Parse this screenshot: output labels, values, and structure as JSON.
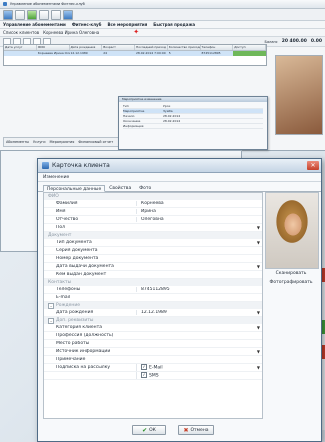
{
  "app": {
    "title": "Управление абонементами Фитнес-клуб",
    "menu": [
      "Управление абонементами",
      "Фитнес-клуб",
      "Все мероприятия",
      "Быстрая продажа"
    ],
    "subtabs": [
      "Список клиентов",
      "Корнеева Ирина Олеговна"
    ],
    "balance_label": "Баланс",
    "balance_value": "20 400.00",
    "balance_value2": "0.00",
    "grid_headers": [
      "Дата услуг",
      "ФИО",
      "Дата рождения",
      "Возраст",
      "Последний приход",
      "Количество приходов",
      "Телефон",
      "Доступ"
    ],
    "grid_row": [
      "",
      "Корнеева Ирина Олеговна",
      "12.12.1989",
      "24",
      "28.02.2014 7:00:00",
      "5",
      "8745112895",
      ""
    ],
    "lower_tabs": [
      "Абонементы",
      "Услуги",
      "Мероприятия",
      "Финансовый отчет"
    ]
  },
  "small_dialog": {
    "title": "Мероприятие изменение",
    "rows": [
      {
        "label": "Тип",
        "value": "Урок"
      },
      {
        "label": "Мероприятие",
        "value": "Зумба"
      },
      {
        "label": "Начало",
        "value": "28.02.2014"
      },
      {
        "label": "Окончание",
        "value": "28.02.2014"
      },
      {
        "label": "Информация",
        "value": ""
      }
    ]
  },
  "dialog": {
    "title": "Карточка клиента",
    "menu_label": "Изменение",
    "tabs": [
      "Персональные данные",
      "Свойства",
      "Фото"
    ],
    "categories": {
      "fio": "ФИО",
      "document": "Документ",
      "contacts": "Контакты",
      "birth": "Рождение",
      "extra": "Доп. реквизиты"
    },
    "fields": {
      "last_name": {
        "label": "Фамилия",
        "value": "Корнеева"
      },
      "first_name": {
        "label": "Имя",
        "value": "Ирина"
      },
      "patronymic": {
        "label": "Отчество",
        "value": "Олеговна"
      },
      "gender": {
        "label": "Пол",
        "value": ""
      },
      "doc_type": {
        "label": "Тип документа",
        "value": ""
      },
      "doc_series": {
        "label": "Серия документа",
        "value": ""
      },
      "doc_number": {
        "label": "Номер документа",
        "value": ""
      },
      "doc_issue_date": {
        "label": "Дата выдачи документа",
        "value": ""
      },
      "doc_issued_by": {
        "label": "Кем выдан документ",
        "value": ""
      },
      "phones": {
        "label": "Телефоны",
        "value": "8745112895"
      },
      "email": {
        "label": "E-mail",
        "value": ""
      },
      "birth_date": {
        "label": "Дата рождения",
        "value": "12.12.1989"
      },
      "client_category": {
        "label": "Категория клиента",
        "value": ""
      },
      "profession": {
        "label": "Профессия (должность)",
        "value": ""
      },
      "workplace": {
        "label": "Место работы",
        "value": ""
      },
      "info_source": {
        "label": "Источник информации",
        "value": ""
      },
      "note": {
        "label": "Примечание",
        "value": ""
      },
      "subscription": {
        "label": "Подписка на рассылку",
        "email_label": "E-Mail",
        "sms_label": "SMS"
      }
    },
    "scan_label": "Сканировать",
    "photo_label": "Фотографировать",
    "ok_label": "ОК",
    "cancel_label": "Отмена"
  }
}
